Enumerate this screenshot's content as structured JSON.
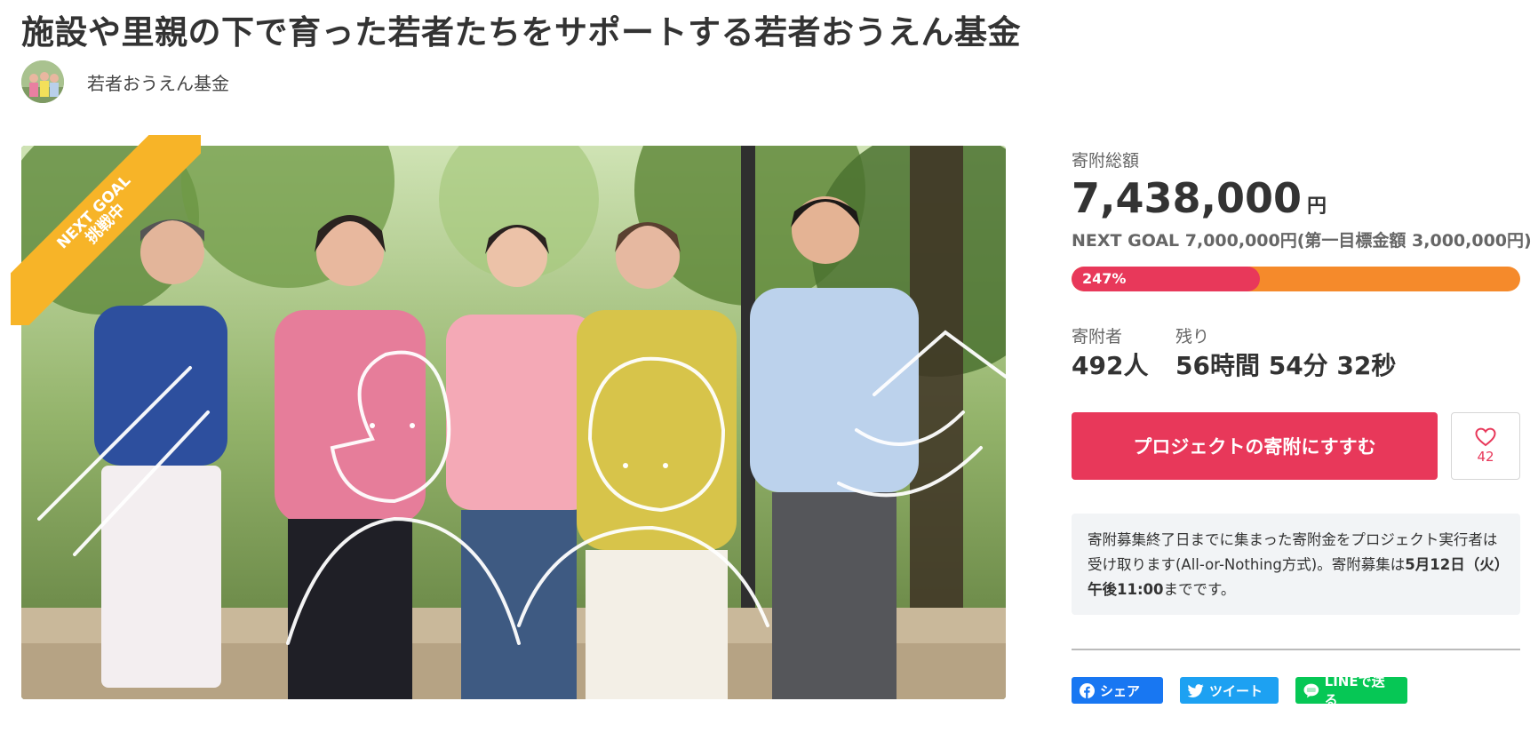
{
  "page": {
    "title": "施設や里親の下で育った若者たちをサポートする若者おうえん基金",
    "owner_name": "若者おうえん基金"
  },
  "hero": {
    "ribbon_line1": "NEXT GOAL",
    "ribbon_line2": "挑戦中"
  },
  "stats": {
    "total_label": "寄附総額",
    "total_amount": "7,438,000",
    "total_unit": "円",
    "next_goal": "NEXT GOAL 7,000,000円(第一目標金額 3,000,000円)",
    "progress_text": "247%",
    "progress_fraction": 0.42,
    "donors_label": "寄附者",
    "donors_value": "492人",
    "remaining_label": "残り",
    "remaining_value": "56時間 54分 32秒"
  },
  "actions": {
    "donate_label": "プロジェクトの寄附にすすむ",
    "favorite_count": "42"
  },
  "notice": {
    "text_part1": "寄附募集終了日までに集まった寄附金をプロジェクト実行者は受け取ります(All-or-Nothing方式)。寄附募集は",
    "text_bold1": "5月12日（火）午後11:00",
    "text_part2": "までです。"
  },
  "share": {
    "facebook_label": "シェア",
    "twitter_label": "ツイート",
    "line_label": "LINEで送る"
  },
  "colors": {
    "accent": "#e8385a",
    "progress_track": "#f58a2b",
    "ribbon": "#f7b428",
    "facebook": "#1877f2",
    "twitter": "#1da1f2",
    "line": "#06c755"
  }
}
